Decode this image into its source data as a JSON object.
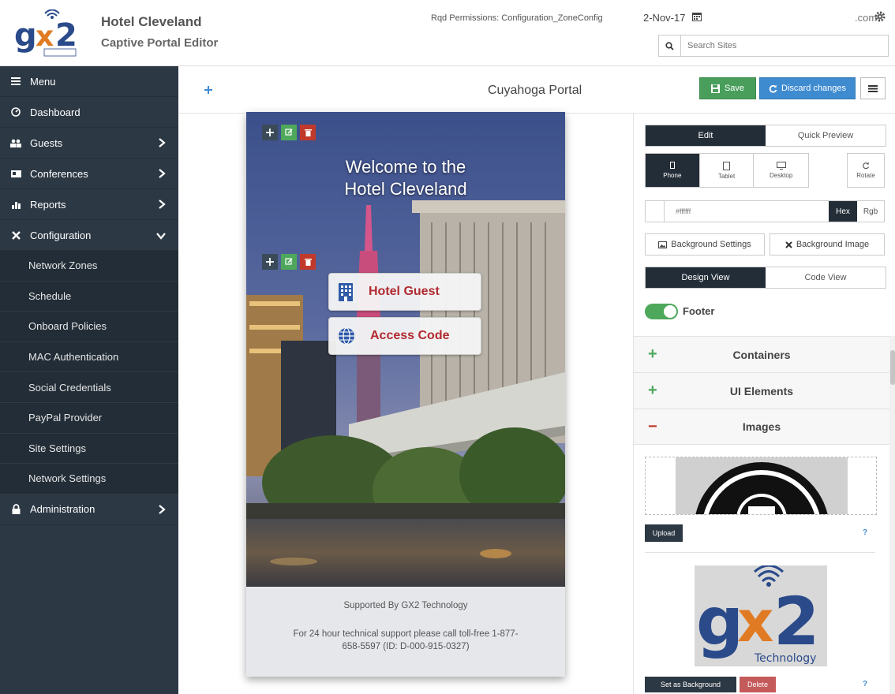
{
  "header": {
    "site_name": "Hotel Cleveland",
    "app_name": "Captive Portal Editor",
    "permissions": "Rqd Permissions: Configuration_ZoneConfig",
    "date": "2-Nov-17",
    "user_email_suffix": ".com",
    "search_placeholder": "Search Sites"
  },
  "logo": {
    "text": "gx2",
    "subtext": "Technology"
  },
  "sidebar": {
    "items": [
      {
        "label": "Menu",
        "icon": "hamburger-icon"
      },
      {
        "label": "Dashboard",
        "icon": "dashboard-icon"
      },
      {
        "label": "Guests",
        "icon": "users-icon"
      },
      {
        "label": "Conferences",
        "icon": "conference-icon"
      },
      {
        "label": "Reports",
        "icon": "chart-icon"
      },
      {
        "label": "Configuration",
        "icon": "tools-icon"
      }
    ],
    "sub_items": [
      {
        "label": "Network Zones"
      },
      {
        "label": "Schedule"
      },
      {
        "label": "Onboard Policies"
      },
      {
        "label": "MAC Authentication"
      },
      {
        "label": "Social Credentials"
      },
      {
        "label": "PayPal Provider"
      },
      {
        "label": "Site Settings"
      },
      {
        "label": "Network Settings"
      }
    ],
    "admin": {
      "label": "Administration",
      "icon": "lock-icon"
    }
  },
  "toolbar": {
    "portal_title": "Cuyahoga Portal",
    "save_label": "Save",
    "discard_label": "Discard changes"
  },
  "preview": {
    "welcome_title": "Welcome to the\nHotel Cleveland",
    "hotel_guest_label": "Hotel Guest",
    "access_code_label": "Access Code",
    "footer_line1": "Supported By GX2 Technology",
    "footer_line2": "For 24 hour technical support please call toll-free 1-877-658-5597 (ID: D-000-915-0327)"
  },
  "panel": {
    "edit_label": "Edit",
    "quick_preview_label": "Quick Preview",
    "devices": [
      {
        "label": "Phone",
        "icon": "phone-icon"
      },
      {
        "label": "Tablet",
        "icon": "tablet-icon"
      },
      {
        "label": "Desktop",
        "icon": "desktop-icon"
      }
    ],
    "rotate_label": "Rotate",
    "color_value": "#ffffff",
    "hex_label": "Hex",
    "rgb_label": "Rgb",
    "bg_settings_label": "Background Settings",
    "bg_image_label": "Background Image",
    "design_view_label": "Design View",
    "code_view_label": "Code View",
    "footer_label": "Footer",
    "accordions": [
      {
        "title": "Containers",
        "sign": "+"
      },
      {
        "title": "UI Elements",
        "sign": "+"
      },
      {
        "title": "Images",
        "sign": "−"
      }
    ],
    "upload_label": "Upload",
    "help_label": "?",
    "set_bg_label": "Set as Background",
    "delete_label": "Delete"
  },
  "colors": {
    "sidebar_bg": "#2c3844",
    "save_green": "#4a9e5c",
    "discard_blue": "#3f8bd0",
    "accent_red": "#b02a30"
  }
}
